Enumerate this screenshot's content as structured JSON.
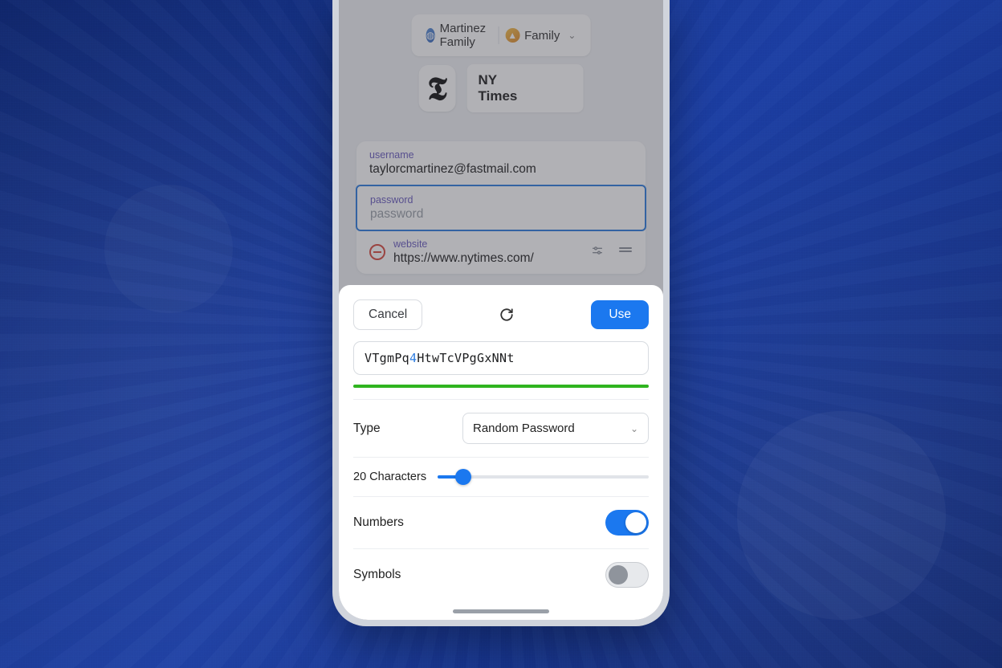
{
  "chips": {
    "account": "Martinez Family",
    "vault": "Family"
  },
  "item": {
    "title": "NY Times",
    "logoGlyph": "𝕿",
    "usernameLabel": "username",
    "usernameValue": "taylorcmartinez@fastmail.com",
    "passwordLabel": "password",
    "passwordPlaceholder": "password",
    "websiteLabel": "website",
    "websiteValue": "https://www.nytimes.com/"
  },
  "sheet": {
    "cancel": "Cancel",
    "use": "Use",
    "password_pre": "VTgmPq",
    "password_digit": "4",
    "password_post": "HtwTcVPgGxNNt",
    "typeLabel": "Type",
    "typeValue": "Random Password",
    "lengthLabel": "20 Characters",
    "sliderPercent": 12,
    "numbersLabel": "Numbers",
    "numbersOn": true,
    "symbolsLabel": "Symbols",
    "symbolsOn": false
  }
}
